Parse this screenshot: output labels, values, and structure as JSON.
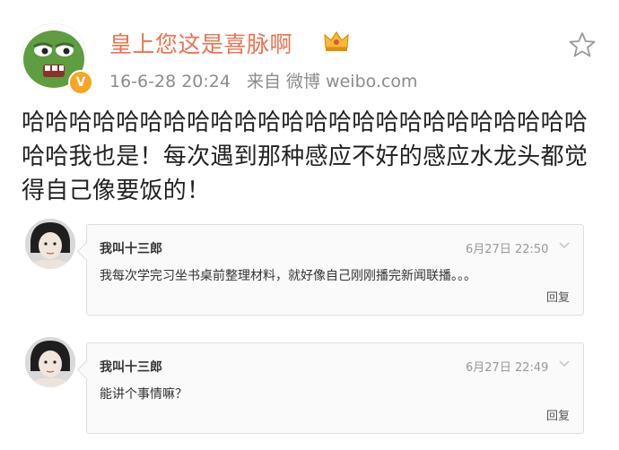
{
  "post": {
    "username": "皇上您这是喜脉啊",
    "date": "16-6-28 20:24",
    "source": "来自 微博 weibo.com",
    "text": "哈哈哈哈哈哈哈哈哈哈哈哈哈哈哈哈哈哈哈哈哈哈哈哈哈哈我也是！每次遇到那种感应不好的感应水龙头都觉得自己像要饭的！",
    "verify_icon": "vip-badge-icon",
    "crown_icon": "crown-icon",
    "star_icon": "favorite-star-icon"
  },
  "comments": [
    {
      "name": "我叫十三郎",
      "time": "6月27日 22:50",
      "text": "我每次学完习坐书桌前整理材料，就好像自己刚刚播完新闻联播。。。",
      "reply_label": "回复"
    },
    {
      "name": "我叫十三郎",
      "time": "6月27日 22:49",
      "text": "能讲个事情嘛？",
      "reply_label": "回复"
    }
  ],
  "colors": {
    "username": "#eb7350",
    "meta": "#8c8c8c",
    "badge": "#f6a623"
  }
}
